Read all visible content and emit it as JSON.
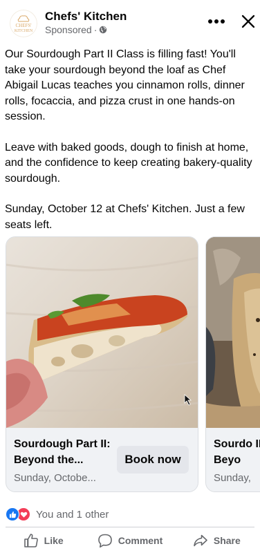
{
  "post": {
    "page_name": "Chefs' Kitchen",
    "logo_text_top": "CHEFS'",
    "logo_text_bottom": "KITCHEN",
    "sponsored_label": "Sponsored",
    "paragraphs": [
      "Our Sourdough Part II Class is filling fast! You'll take your sourdough beyond the loaf as Chef Abigail Lucas teaches you cinnamon rolls, dinner rolls, focaccia, and pizza crust in one hands-on session.",
      "Leave with baked goods, dough to finish at home, and the confidence to keep creating bakery-quality sourdough.",
      "Sunday, October 12 at Chefs' Kitchen. Just a few seats left."
    ]
  },
  "carousel": {
    "cards": [
      {
        "title": "Sourdough Part II: Beyond the...",
        "subtitle": "Sunday, Octobe...",
        "button_label": "Book now"
      },
      {
        "title": "Sourdo II: Beyo",
        "subtitle": "Sunday,"
      }
    ]
  },
  "reactions": {
    "summary": "You and 1 other"
  },
  "actions": {
    "like": "Like",
    "comment": "Comment",
    "share": "Share"
  },
  "colors": {
    "like_blue": "#1877f2",
    "love_red": "#f33e58",
    "muted_text": "#65676b",
    "card_bg": "#f0f2f5"
  }
}
